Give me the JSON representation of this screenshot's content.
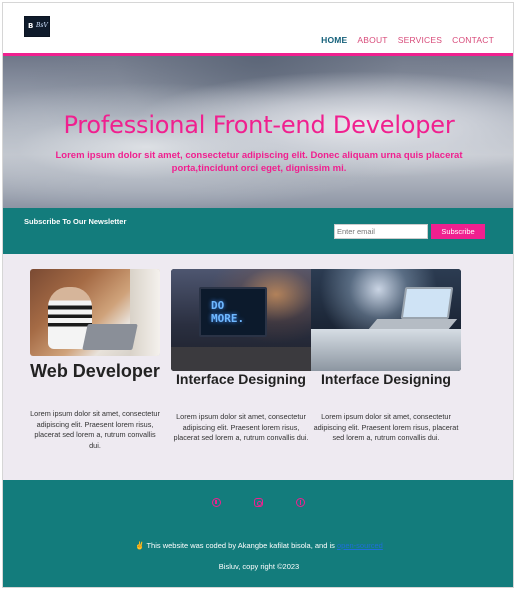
{
  "header": {
    "logo_text_1": "B",
    "logo_text_2": "BsV",
    "nav": [
      {
        "label": "HOME",
        "active": true
      },
      {
        "label": "ABOUT",
        "active": false
      },
      {
        "label": "SERVICES",
        "active": false
      },
      {
        "label": "CONTACT",
        "active": false
      }
    ]
  },
  "hero": {
    "title": "Professional Front-end Developer",
    "subtitle": "Lorem ipsum dolor sit amet, consectetur adipiscing elit. Donec aliquam urna quis placerat porta,tincidunt orci eget, dignissim mi."
  },
  "newsletter": {
    "label": "Subscribe To Our Newsletter",
    "input_placeholder": "Enter email",
    "button_label": "Subscribe"
  },
  "cards": [
    {
      "title": "Web Developer",
      "text": "Lorem ipsum dolor sit amet, consectetur adipiscing elit. Praesent lorem risus, placerat sed lorem a, rutrum convallis dui."
    },
    {
      "title": "Interface Designing",
      "text": "Lorem ipsum dolor sit amet, consectetur adipiscing elit. Praesent lorem risus, placerat sed lorem a, rutrum convallis dui."
    },
    {
      "title": "Interface Designing",
      "text": "Lorem ipsum dolor sit amet, consectetur adipiscing elit. Praesent lorem risus, placerat sed lorem a, rutrum convallis dui."
    }
  ],
  "image_text": {
    "monitor_line_1": "DO",
    "monitor_line_2": "MORE."
  },
  "footer": {
    "social_icons": [
      "github-icon",
      "instagram-icon",
      "pinterest-icon"
    ],
    "credit_emoji": "✌",
    "credit_text": "This website was coded by Akangbe kafilat bisola, and is",
    "credit_link": "open-sourced",
    "copyright": "Bisluv, copy right ©2023"
  },
  "colors": {
    "accent": "#f0208f",
    "teal": "#137c7c",
    "nav_active": "#14607a",
    "section_bg": "#eeeaf1"
  }
}
